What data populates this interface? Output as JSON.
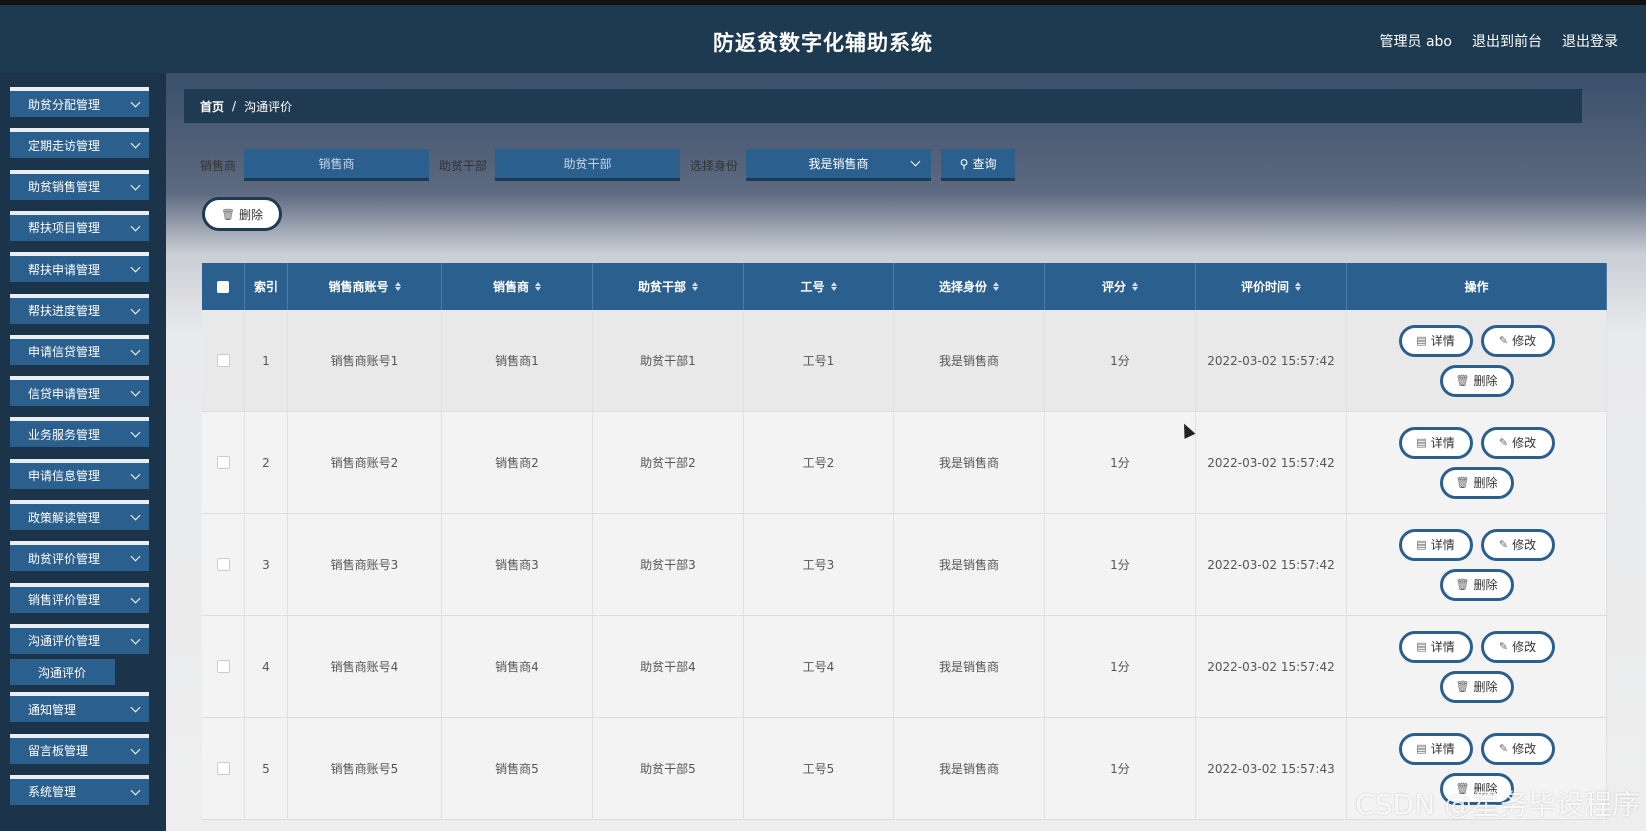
{
  "header": {
    "title": "防返贫数字化辅助系统",
    "links": [
      "管理员 abo",
      "退出到前台",
      "退出登录"
    ]
  },
  "sidebar": {
    "items": [
      "助贫分配管理",
      "定期走访管理",
      "助贫销售管理",
      "帮扶项目管理",
      "帮扶申请管理",
      "帮扶进度管理",
      "申请信贷管理",
      "信贷申请管理",
      "业务服务管理",
      "申请信息管理",
      "政策解读管理",
      "助贫评价管理",
      "销售评价管理",
      "沟通评价管理"
    ],
    "active_sub": "沟通评价",
    "items_after": [
      "通知管理",
      "留言板管理",
      "系统管理"
    ]
  },
  "breadcrumb": {
    "home": "首页",
    "separator": "/",
    "current": "沟通评价"
  },
  "search": {
    "seller_label": "销售商",
    "seller_placeholder": "销售商",
    "cadre_label": "助贫干部",
    "cadre_placeholder": "助贫干部",
    "identity_label": "选择身份",
    "identity_value": "我是销售商",
    "query_label": "查询"
  },
  "delete_label": "删除",
  "table": {
    "headers": [
      "索引",
      "销售商账号",
      "销售商",
      "助贫干部",
      "工号",
      "选择身份",
      "评分",
      "评价时间",
      "操作"
    ],
    "rows": [
      [
        "1",
        "销售商账号1",
        "销售商1",
        "助贫干部1",
        "工号1",
        "我是销售商",
        "1分",
        "2022-03-02 15:57:42"
      ],
      [
        "2",
        "销售商账号2",
        "销售商2",
        "助贫干部2",
        "工号2",
        "我是销售商",
        "1分",
        "2022-03-02 15:57:42"
      ],
      [
        "3",
        "销售商账号3",
        "销售商3",
        "助贫干部3",
        "工号3",
        "我是销售商",
        "1分",
        "2022-03-02 15:57:42"
      ],
      [
        "4",
        "销售商账号4",
        "销售商4",
        "助贫干部4",
        "工号4",
        "我是销售商",
        "1分",
        "2022-03-02 15:57:42"
      ],
      [
        "5",
        "销售商账号5",
        "销售商5",
        "助贫干部5",
        "工号5",
        "我是销售商",
        "1分",
        "2022-03-02 15:57:43"
      ]
    ],
    "op_detail": "详情",
    "op_edit": "修改",
    "op_delete": "删除"
  },
  "watermark": "CSDN @星务毕设程序"
}
